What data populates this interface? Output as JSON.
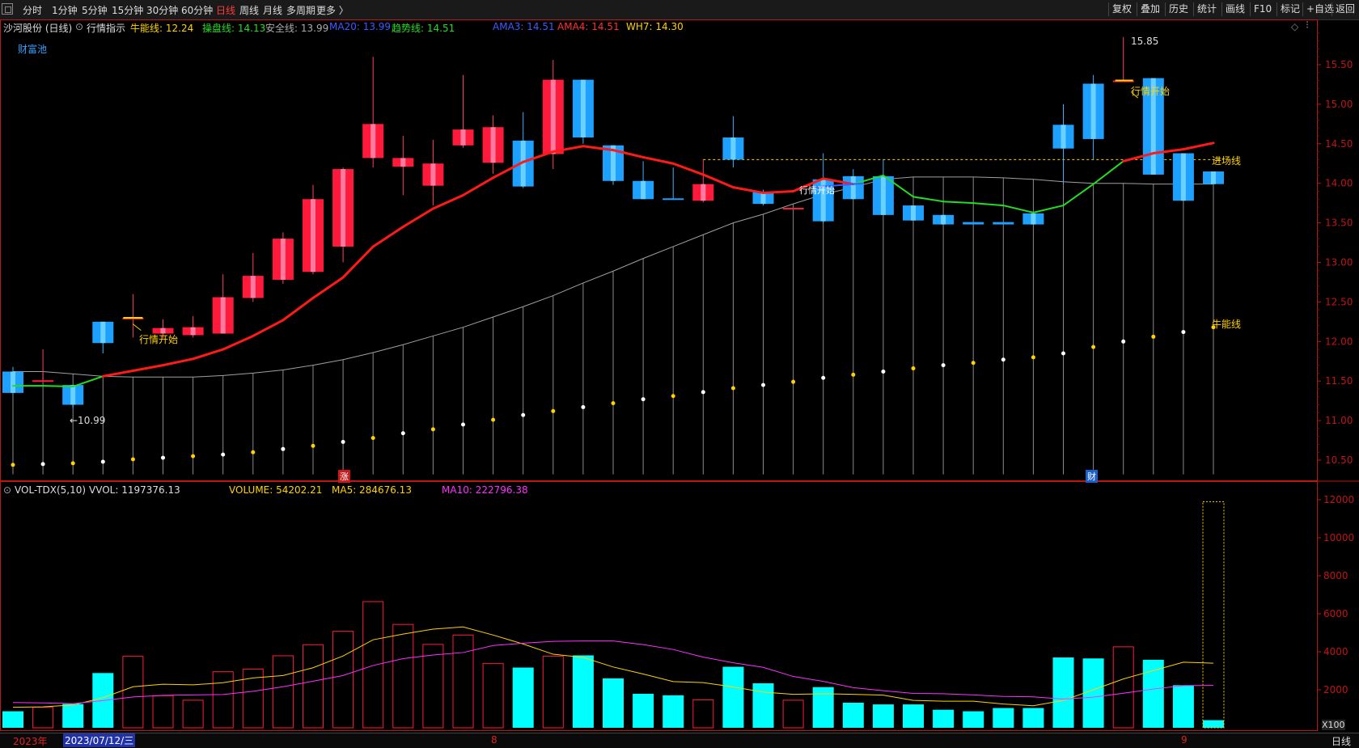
{
  "toolbar": {
    "periods": [
      "分时",
      "1分钟",
      "5分钟",
      "15分钟",
      "30分钟",
      "60分钟",
      "日线",
      "周线",
      "月线",
      "多周期",
      "更多 〉"
    ],
    "active_period": "日线",
    "right_buttons": [
      "复权",
      "叠加",
      "历史",
      "统计",
      "画线",
      "F10",
      "标记",
      "+自选",
      "返回"
    ]
  },
  "header": {
    "stock": "沙河股份 (日线)",
    "indicator_name": "行情指示",
    "items": [
      {
        "text": "牛能线: 12.24",
        "color": "#ffd200"
      },
      {
        "text": "操盘线: 14.13",
        "color": "#22dd22"
      },
      {
        "text": "安全线: 13.99",
        "color": "#aaaaaa"
      },
      {
        "text": "MA20: 13.99",
        "color": "#3a5cff"
      },
      {
        "text": "趋势线: 14.51",
        "color": "#22dd22"
      },
      {
        "text": "AMA3: 14.51",
        "color": "#3a5cff"
      },
      {
        "text": "AMA4: 14.51",
        "color": "#ff3030"
      },
      {
        "text": "WH7: 14.30",
        "color": "#ffd200"
      }
    ],
    "pool_label": "财富池"
  },
  "vol_header": {
    "name": "VOL-TDX(5,10)",
    "items": [
      {
        "text": "VVOL: 1197376.13",
        "color": "#dddddd"
      },
      {
        "text": "VOLUME: 54202.21",
        "color": "#ffd200"
      },
      {
        "text": "MA5: 284676.13",
        "color": "#ffd200"
      },
      {
        "text": "MA10: 222796.38",
        "color": "#ff30ff"
      }
    ]
  },
  "annotations": {
    "low_price": "←10.99",
    "high_price": "15.85",
    "start1": "行情开始",
    "start2": "行情开始",
    "start3": "行情开始",
    "entry_line": "进场线",
    "bull_line": "牛能线",
    "zhang": "涨",
    "cai": "财"
  },
  "status": {
    "year": "2023年",
    "date": "2023/07/12/三",
    "month8": "8",
    "month9": "9",
    "period": "日线",
    "multiplier": "X100"
  },
  "colors": {
    "up": "#ff1a3c",
    "down": "#1ea0ff",
    "ma": "#ff1a1a",
    "trend_green": "#22dd22",
    "gray": "#a0a0a0",
    "yellow": "#ffd200",
    "magenta": "#ff30ff",
    "cyan": "#00ffff",
    "axis_red": "#cc1111"
  },
  "chart_data": {
    "type": "candlestick",
    "price_axis": {
      "ticks": [
        10.5,
        11.0,
        11.5,
        12.0,
        12.5,
        13.0,
        13.5,
        14.0,
        14.5,
        15.0,
        15.5
      ],
      "range": [
        10.35,
        15.95
      ]
    },
    "volume_axis": {
      "ticks": [
        2000,
        4000,
        6000,
        8000,
        10000,
        12000
      ],
      "range": [
        0,
        12800
      ]
    },
    "candles": [
      {
        "o": 11.62,
        "h": 11.68,
        "l": 11.33,
        "c": 11.35
      },
      {
        "o": 11.51,
        "h": 11.9,
        "l": 11.5,
        "c": 11.51
      },
      {
        "o": 11.45,
        "h": 11.45,
        "l": 11.16,
        "c": 11.2
      },
      {
        "o": 12.25,
        "h": 12.25,
        "l": 11.85,
        "c": 11.98
      },
      {
        "o": 12.3,
        "h": 12.6,
        "l": 12.05,
        "c": 12.3
      },
      {
        "o": 12.1,
        "h": 12.28,
        "l": 12.04,
        "c": 12.17
      },
      {
        "o": 12.08,
        "h": 12.32,
        "l": 12.05,
        "c": 12.18
      },
      {
        "o": 12.1,
        "h": 12.85,
        "l": 12.1,
        "c": 12.56
      },
      {
        "o": 12.55,
        "h": 13.12,
        "l": 12.5,
        "c": 12.83
      },
      {
        "o": 12.78,
        "h": 13.38,
        "l": 12.73,
        "c": 13.3
      },
      {
        "o": 12.88,
        "h": 13.98,
        "l": 12.85,
        "c": 13.8
      },
      {
        "o": 13.2,
        "h": 14.2,
        "l": 13.0,
        "c": 14.18
      },
      {
        "o": 14.32,
        "h": 15.6,
        "l": 14.2,
        "c": 14.75
      },
      {
        "o": 14.21,
        "h": 14.6,
        "l": 13.85,
        "c": 14.32
      },
      {
        "o": 13.97,
        "h": 14.55,
        "l": 13.72,
        "c": 14.25
      },
      {
        "o": 14.48,
        "h": 15.37,
        "l": 14.45,
        "c": 14.68
      },
      {
        "o": 14.26,
        "h": 14.86,
        "l": 14.12,
        "c": 14.71
      },
      {
        "o": 14.54,
        "h": 14.9,
        "l": 13.94,
        "c": 13.96
      },
      {
        "o": 14.37,
        "h": 15.56,
        "l": 14.18,
        "c": 15.31
      },
      {
        "o": 15.31,
        "h": 15.31,
        "l": 14.5,
        "c": 14.58
      },
      {
        "o": 14.48,
        "h": 14.48,
        "l": 13.98,
        "c": 14.03
      },
      {
        "o": 14.03,
        "h": 14.28,
        "l": 13.8,
        "c": 13.8
      },
      {
        "o": 13.81,
        "h": 14.2,
        "l": 13.79,
        "c": 13.8
      },
      {
        "o": 13.78,
        "h": 14.3,
        "l": 13.76,
        "c": 13.99
      },
      {
        "o": 14.58,
        "h": 14.85,
        "l": 14.2,
        "c": 14.3
      },
      {
        "o": 13.89,
        "h": 13.92,
        "l": 13.72,
        "c": 13.74
      },
      {
        "o": 13.69,
        "h": 13.69,
        "l": 13.69,
        "c": 13.69
      },
      {
        "o": 14.05,
        "h": 14.38,
        "l": 13.5,
        "c": 13.52
      },
      {
        "o": 14.09,
        "h": 14.18,
        "l": 13.8,
        "c": 13.8
      },
      {
        "o": 14.09,
        "h": 14.3,
        "l": 13.6,
        "c": 13.6
      },
      {
        "o": 13.72,
        "h": 13.72,
        "l": 13.53,
        "c": 13.53
      },
      {
        "o": 13.6,
        "h": 13.6,
        "l": 13.48,
        "c": 13.48
      },
      {
        "o": 13.51,
        "h": 13.51,
        "l": 13.48,
        "c": 13.48
      },
      {
        "o": 13.51,
        "h": 13.51,
        "l": 13.48,
        "c": 13.48
      },
      {
        "o": 13.62,
        "h": 13.62,
        "l": 13.48,
        "c": 13.48
      },
      {
        "o": 14.74,
        "h": 15.0,
        "l": 13.99,
        "c": 14.44
      },
      {
        "o": 15.26,
        "h": 15.37,
        "l": 14.3,
        "c": 14.56
      },
      {
        "o": 15.3,
        "h": 15.85,
        "l": 15.3,
        "c": 15.3
      },
      {
        "o": 15.33,
        "h": 15.33,
        "l": 14.11,
        "c": 14.11
      },
      {
        "o": 14.38,
        "h": 14.38,
        "l": 13.78,
        "c": 13.78
      },
      {
        "o": 14.15,
        "h": 14.15,
        "l": 13.99,
        "c": 13.99
      }
    ],
    "trend_line": [
      11.44,
      11.44,
      11.43,
      11.56,
      11.63,
      11.7,
      11.78,
      11.9,
      12.07,
      12.27,
      12.55,
      12.81,
      13.2,
      13.45,
      13.68,
      13.85,
      14.07,
      14.27,
      14.4,
      14.47,
      14.42,
      14.33,
      14.25,
      14.11,
      13.95,
      13.88,
      13.9,
      14.06,
      13.99,
      14.1,
      13.83,
      13.77,
      13.75,
      13.72,
      13.63,
      13.72,
      13.99,
      14.28,
      14.38,
      14.43,
      14.51
    ],
    "trend_green_index": [
      0,
      1,
      2,
      3,
      28,
      29,
      30,
      31,
      32,
      33,
      34,
      35,
      36,
      37
    ],
    "safety_line": [
      11.62,
      11.62,
      11.59,
      11.56,
      11.55,
      11.55,
      11.55,
      11.57,
      11.6,
      11.64,
      11.7,
      11.77,
      11.86,
      11.96,
      12.07,
      12.18,
      12.31,
      12.44,
      12.58,
      12.74,
      12.89,
      13.05,
      13.2,
      13.35,
      13.5,
      13.61,
      13.74,
      13.86,
      13.95,
      14.05,
      14.08,
      14.08,
      14.08,
      14.07,
      14.05,
      14.02,
      14.0,
      14.0,
      13.99,
      13.99,
      13.99
    ],
    "bull_dots": [
      10.44,
      10.45,
      10.46,
      10.48,
      10.51,
      10.53,
      10.55,
      10.57,
      10.6,
      10.64,
      10.68,
      10.73,
      10.78,
      10.84,
      10.89,
      10.95,
      11.01,
      11.07,
      11.12,
      11.17,
      11.22,
      11.27,
      11.31,
      11.36,
      11.41,
      11.45,
      11.49,
      11.54,
      11.58,
      11.62,
      11.66,
      11.7,
      11.73,
      11.77,
      11.8,
      11.85,
      11.93,
      12.0,
      12.06,
      12.12,
      12.18,
      12.24
    ],
    "entry_line": 14.3,
    "volume": [
      870,
      1080,
      1250,
      2880,
      3760,
      1690,
      1450,
      2950,
      3090,
      3790,
      4370,
      5080,
      6640,
      5440,
      4390,
      4880,
      3390,
      3170,
      3770,
      3810,
      2600,
      1790,
      1710,
      1470,
      3210,
      2340,
      1450,
      2140,
      1320,
      1230,
      1230,
      950,
      870,
      1040,
      1040,
      3700,
      3650,
      4260,
      3580,
      2240,
      400
    ],
    "volume_special": 11900,
    "vol_ma5": [
      1080,
      1100,
      1200,
      1580,
      2160,
      2290,
      2260,
      2370,
      2620,
      2750,
      3160,
      3780,
      4630,
      4930,
      5190,
      5310,
      4880,
      4410,
      3870,
      3700,
      3200,
      2830,
      2430,
      2380,
      2150,
      1880,
      1760,
      1790,
      1760,
      1720,
      1440,
      1400,
      1400,
      1250,
      1160,
      1440,
      2000,
      2570,
      3010,
      3450,
      3400,
      2700
    ],
    "vol_ma10": [
      1330,
      1310,
      1270,
      1430,
      1620,
      1710,
      1730,
      1750,
      1920,
      2160,
      2450,
      2750,
      3280,
      3640,
      3830,
      3960,
      4330,
      4450,
      4550,
      4570,
      4570,
      4380,
      4120,
      3720,
      3420,
      3180,
      2700,
      2440,
      2110,
      1950,
      1810,
      1790,
      1730,
      1650,
      1630,
      1510,
      1610,
      1820,
      2040,
      2220,
      2230
    ]
  }
}
